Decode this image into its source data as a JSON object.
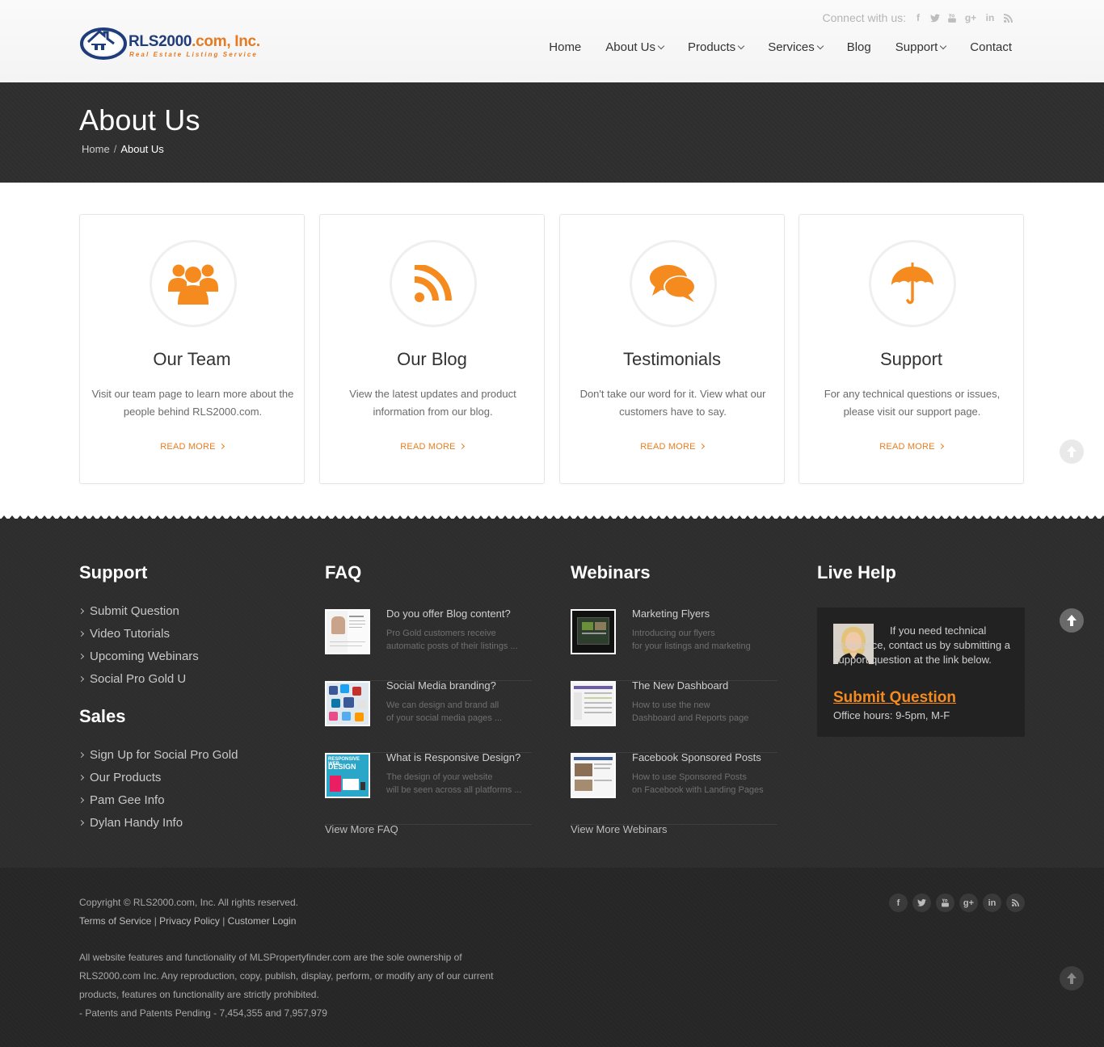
{
  "header": {
    "logo": {
      "name": "RLS2000",
      "name_orange": ".com, Inc.",
      "tagline": "Real Estate Listing Service"
    },
    "connect_label": "Connect with us:",
    "social_icons": [
      "facebook-icon",
      "twitter-icon",
      "youtube-icon",
      "google-plus-icon",
      "linkedin-icon",
      "rss-icon"
    ],
    "nav": [
      {
        "label": "Home",
        "dropdown": false
      },
      {
        "label": "About Us",
        "dropdown": true
      },
      {
        "label": "Products",
        "dropdown": true
      },
      {
        "label": "Services",
        "dropdown": true
      },
      {
        "label": "Blog",
        "dropdown": false
      },
      {
        "label": "Support",
        "dropdown": true
      },
      {
        "label": "Contact",
        "dropdown": false
      }
    ]
  },
  "page": {
    "title": "About Us",
    "breadcrumb": {
      "home": "Home",
      "separator": "/",
      "current": "About Us"
    }
  },
  "cards": [
    {
      "icon": "users-icon",
      "title": "Our Team",
      "desc": "Visit our team page to learn more about the people behind RLS2000.com.",
      "more": "READ MORE"
    },
    {
      "icon": "rss-icon",
      "title": "Our Blog",
      "desc": "View the latest updates and product information from our blog.",
      "more": "READ MORE"
    },
    {
      "icon": "comments-icon",
      "title": "Testimonials",
      "desc": "Don't take our word for it. View what our customers have to say.",
      "more": "READ MORE"
    },
    {
      "icon": "umbrella-icon",
      "title": "Support",
      "desc": "For any technical questions or issues, please visit our support page.",
      "more": "READ MORE"
    }
  ],
  "footer": {
    "support": {
      "title": "Support",
      "items": [
        "Submit Question",
        "Video Tutorials",
        "Upcoming Webinars",
        "Social Pro Gold U"
      ]
    },
    "sales": {
      "title": "Sales",
      "items": [
        "Sign Up for Social Pro Gold",
        "Our Products",
        "Pam Gee Info",
        "Dylan Handy Info"
      ]
    },
    "faq": {
      "title": "FAQ",
      "posts": [
        {
          "title": "Do you offer Blog content?",
          "desc": "Pro Gold customers receive\nautomatic posts of their listings ..."
        },
        {
          "title": "Social Media branding?",
          "desc": "We can design and brand all\nof your social media pages ..."
        },
        {
          "title": "What is Responsive Design?",
          "desc": "The design of your website\nwill be seen across all platforms ..."
        }
      ],
      "view_more": "View More FAQ"
    },
    "webinars": {
      "title": "Webinars",
      "posts": [
        {
          "title": "Marketing Flyers",
          "desc": "Introducing our flyers\nfor your listings and marketing"
        },
        {
          "title": "The New Dashboard",
          "desc": "How to use the new\nDashboard and Reports page"
        },
        {
          "title": "Facebook Sponsored Posts",
          "desc": "How to use Sponsored Posts\non Facebook with Landing Pages"
        }
      ],
      "view_more": "View More Webinars"
    },
    "live_help": {
      "title": "Live Help",
      "text": "If you need technical assistance, contact us by submitting a support question at the link below.",
      "link": "Submit Question",
      "hours": "Office hours: 9-5pm, M-F"
    }
  },
  "bottom": {
    "copyright": "Copyright © RLS2000.com, Inc. All rights reserved.",
    "links": [
      "Terms of Service",
      "Privacy Policy",
      "Customer Login"
    ],
    "link_sep": "|",
    "legal_1": "All website features and functionality of MLSPropertyfinder.com are the sole ownership of",
    "legal_2": "RLS2000.com Inc. Any reproduction, copy, publish, display, perform, or modify any of our current",
    "legal_3": "products, features on functionality are strictly prohibited.",
    "legal_4": "- Patents and Patents Pending - 7,454,355 and 7,957,979",
    "social_icons": [
      "facebook-icon",
      "twitter-icon",
      "youtube-icon",
      "google-plus-icon",
      "linkedin-icon",
      "rss-icon"
    ]
  },
  "colors": {
    "accent": "#f58a1f",
    "dark_band": "#2e2e2e",
    "footer": "#2d2d2d",
    "bottom": "#262626"
  }
}
